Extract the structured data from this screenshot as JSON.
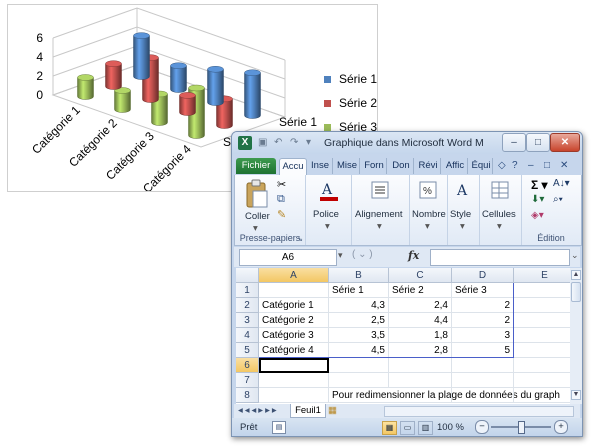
{
  "chart_data": {
    "type": "bar",
    "style": "3d-clustered-column",
    "categories": [
      "Catégorie 1",
      "Catégorie 2",
      "Catégorie 3",
      "Catégorie 4"
    ],
    "series": [
      {
        "name": "Série 1",
        "values": [
          4.3,
          2.5,
          3.5,
          4.5
        ],
        "color": "#4f81bd"
      },
      {
        "name": "Série 2",
        "values": [
          2.4,
          4.4,
          1.8,
          2.8
        ],
        "color": "#c0504d"
      },
      {
        "name": "Série 3",
        "values": [
          2,
          2,
          3,
          5
        ],
        "color": "#9bbb59"
      }
    ],
    "depth_labels": [
      "Série 3",
      "Série 1"
    ],
    "yticks": [
      "0",
      "2",
      "4",
      "6"
    ],
    "ylim": [
      0,
      6
    ],
    "grid": true,
    "legend_position": "right"
  },
  "window": {
    "title": "Graphique dans Microsoft Word M",
    "app_icon": "X",
    "minimize_label": "–",
    "maximize_label": "□",
    "close_label": "✕"
  },
  "ribbon": {
    "tabs": [
      "Fichier",
      "Accu",
      "Inse",
      "Mise",
      "Forn",
      "Don",
      "Révi",
      "Affic",
      "Équi"
    ],
    "groups": {
      "clipboard": {
        "label": "Presse-papiers",
        "paste": "Coller"
      },
      "police": "Police",
      "alignement": "Alignement",
      "nombre": "Nombre",
      "style": "Style",
      "cellules": "Cellules",
      "edition": "Édition"
    }
  },
  "formula_bar": {
    "name_box": "A6",
    "fx": "fx",
    "value": ""
  },
  "sheet": {
    "columns": [
      "A",
      "B",
      "C",
      "D",
      "E"
    ],
    "selected_column": "A",
    "rows": [
      {
        "num": "1",
        "cells": [
          "",
          "Série 1",
          "Série 2",
          "Série 3",
          ""
        ]
      },
      {
        "num": "2",
        "cells": [
          "Catégorie 1",
          "4,3",
          "2,4",
          "2",
          ""
        ]
      },
      {
        "num": "3",
        "cells": [
          "Catégorie 2",
          "2,5",
          "4,4",
          "2",
          ""
        ]
      },
      {
        "num": "4",
        "cells": [
          "Catégorie 3",
          "3,5",
          "1,8",
          "3",
          ""
        ]
      },
      {
        "num": "5",
        "cells": [
          "Catégorie 4",
          "4,5",
          "2,8",
          "5",
          ""
        ]
      },
      {
        "num": "6",
        "cells": [
          "",
          "",
          "",
          "",
          ""
        ]
      },
      {
        "num": "7",
        "cells": [
          "",
          "",
          "",
          "",
          ""
        ]
      },
      {
        "num": "8",
        "cells": [
          "",
          "Pour redimensionner la plage de données du graph",
          "",
          "",
          ""
        ]
      }
    ],
    "selected_row": "6",
    "sheet_tab": "Feuil1"
  },
  "status": {
    "ready": "Prêt",
    "zoom": "100 %",
    "zoom_minus": "−",
    "zoom_plus": "+"
  }
}
